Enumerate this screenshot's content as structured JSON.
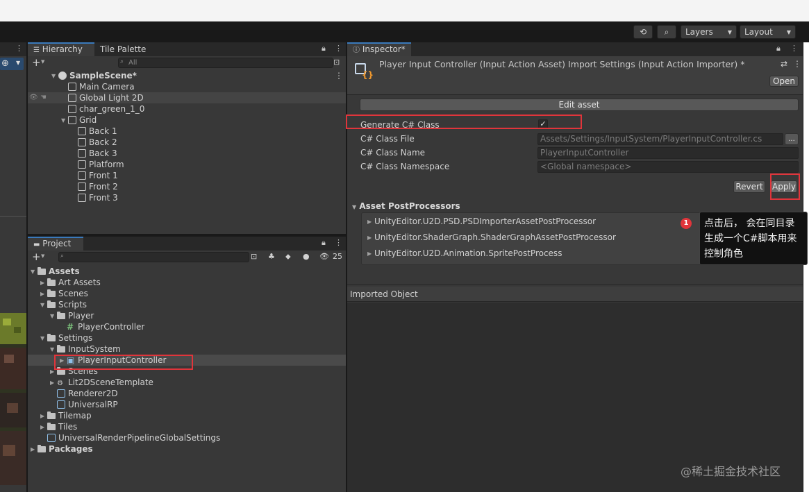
{
  "toolbar": {
    "layers_label": "Layers",
    "layout_label": "Layout"
  },
  "hierarchy": {
    "tab_label": "Hierarchy",
    "second_tab_label": "Tile Palette",
    "search_placeholder": "All",
    "items": [
      {
        "label": "SampleScene*",
        "depth": 0,
        "icon": "unity-scene-icon",
        "expanded": true,
        "bold": true
      },
      {
        "label": "Main Camera",
        "depth": 1,
        "icon": "gameobject-cube-icon"
      },
      {
        "label": "Global Light 2D",
        "depth": 1,
        "icon": "gameobject-cube-icon",
        "selected_hover": true
      },
      {
        "label": "char_green_1_0",
        "depth": 1,
        "icon": "gameobject-cube-icon"
      },
      {
        "label": "Grid",
        "depth": 1,
        "icon": "gameobject-cube-icon",
        "expanded": true
      },
      {
        "label": "Back 1",
        "depth": 2,
        "icon": "gameobject-cube-icon"
      },
      {
        "label": "Back 2",
        "depth": 2,
        "icon": "gameobject-cube-icon"
      },
      {
        "label": "Back 3",
        "depth": 2,
        "icon": "gameobject-cube-icon"
      },
      {
        "label": "Platform",
        "depth": 2,
        "icon": "gameobject-cube-icon"
      },
      {
        "label": "Front 1",
        "depth": 2,
        "icon": "gameobject-cube-icon"
      },
      {
        "label": "Front 2",
        "depth": 2,
        "icon": "gameobject-cube-icon"
      },
      {
        "label": "Front 3",
        "depth": 2,
        "icon": "gameobject-cube-icon"
      }
    ]
  },
  "project": {
    "tab_label": "Project",
    "hidden_count": "25",
    "items": [
      {
        "label": "Assets",
        "depth": 0,
        "type": "folder",
        "expanded": true,
        "bold": true
      },
      {
        "label": "Art Assets",
        "depth": 1,
        "type": "folder",
        "collapsed": true
      },
      {
        "label": "Scenes",
        "depth": 1,
        "type": "folder",
        "collapsed": true
      },
      {
        "label": "Scripts",
        "depth": 1,
        "type": "folder",
        "expanded": true
      },
      {
        "label": "Player",
        "depth": 2,
        "type": "folder",
        "expanded": true
      },
      {
        "label": "PlayerController",
        "depth": 3,
        "type": "script"
      },
      {
        "label": "Settings",
        "depth": 1,
        "type": "folder",
        "expanded": true
      },
      {
        "label": "InputSystem",
        "depth": 2,
        "type": "folder",
        "expanded": true
      },
      {
        "label": "PlayerInputController",
        "depth": 3,
        "type": "inputasset",
        "collapsed": true,
        "selected": true
      },
      {
        "label": "Scenes",
        "depth": 2,
        "type": "folder",
        "collapsed": true
      },
      {
        "label": "Lit2DSceneTemplate",
        "depth": 2,
        "type": "template",
        "collapsed": true
      },
      {
        "label": "Renderer2D",
        "depth": 2,
        "type": "asset"
      },
      {
        "label": "UniversalRP",
        "depth": 2,
        "type": "asset"
      },
      {
        "label": "Tilemap",
        "depth": 1,
        "type": "folder",
        "collapsed": true
      },
      {
        "label": "Tiles",
        "depth": 1,
        "type": "folder",
        "collapsed": true
      },
      {
        "label": "UniversalRenderPipelineGlobalSettings",
        "depth": 1,
        "type": "asset"
      },
      {
        "label": "Packages",
        "depth": 0,
        "type": "folder",
        "collapsed": true,
        "bold": true
      }
    ]
  },
  "inspector": {
    "tab_label": "Inspector*",
    "title": "Player Input Controller (Input Action Asset) Import Settings (Input Action Importer) *",
    "open_label": "Open",
    "edit_asset_label": "Edit asset",
    "fields": {
      "generate_label": "Generate C# Class",
      "generate_checked": true,
      "class_file_label": "C# Class File",
      "class_file_value": "Assets/Settings/InputSystem/PlayerInputController.cs",
      "class_file_browse": "...",
      "class_name_label": "C# Class Name",
      "class_name_value": "PlayerInputController",
      "namespace_label": "C# Class Namespace",
      "namespace_value": "<Global namespace>"
    },
    "revert_label": "Revert",
    "apply_label": "Apply",
    "postprocessors_header": "Asset PostProcessors",
    "postprocessors": [
      "UnityEditor.U2D.PSD.PSDImporterAssetPostProcessor",
      "UnityEditor.ShaderGraph.ShaderGraphAssetPostProcessor",
      "UnityEditor.U2D.Animation.SpritePostProcess"
    ],
    "imported_object_label": "Imported Object"
  },
  "annotation": {
    "badge": "1",
    "text": "点击后， 会在同目录生成一个C#脚本用来控制角色"
  },
  "watermark": "@稀土掘金技术社区",
  "colors": {
    "highlight_red": "#e0353b",
    "selection_blue": "#2c5d87",
    "panel_bg": "#383838",
    "window_bg": "#191919"
  }
}
